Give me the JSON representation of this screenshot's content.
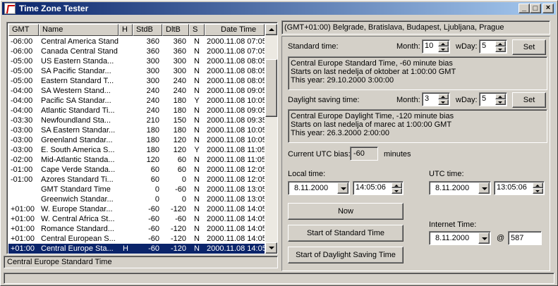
{
  "window": {
    "title": "Time Zone Tester"
  },
  "list": {
    "columns": [
      "GMT",
      "Name",
      "H",
      "StdB",
      "DltB",
      "S",
      "Date Time"
    ],
    "rows": [
      [
        "-06:00",
        "Central America Stand...",
        "",
        "360",
        "360",
        "N",
        "2000.11.08 07:05"
      ],
      [
        "-06:00",
        "Canada Central Stand...",
        "",
        "360",
        "360",
        "N",
        "2000.11.08 07:05"
      ],
      [
        "-05:00",
        "US Eastern Standa...",
        "",
        "300",
        "300",
        "N",
        "2000.11.08 08:05"
      ],
      [
        "-05:00",
        "SA Pacific Standar...",
        "",
        "300",
        "300",
        "N",
        "2000.11.08 08:05"
      ],
      [
        "-05:00",
        "Eastern Standard T...",
        "",
        "300",
        "240",
        "N",
        "2000.11.08 08:05"
      ],
      [
        "-04:00",
        "SA Western Stand...",
        "",
        "240",
        "240",
        "N",
        "2000.11.08 09:05"
      ],
      [
        "-04:00",
        "Pacific SA Standar...",
        "",
        "240",
        "180",
        "Y",
        "2000.11.08 10:05"
      ],
      [
        "-04:00",
        "Atlantic Standard Ti...",
        "",
        "240",
        "180",
        "N",
        "2000.11.08 09:05"
      ],
      [
        "-03:30",
        "Newfoundland Sta...",
        "",
        "210",
        "150",
        "N",
        "2000.11.08 09:35"
      ],
      [
        "-03:00",
        "SA Eastern Standar...",
        "",
        "180",
        "180",
        "N",
        "2000.11.08 10:05"
      ],
      [
        "-03:00",
        "Greenland Standar...",
        "",
        "180",
        "120",
        "N",
        "2000.11.08 10:05"
      ],
      [
        "-03:00",
        "E. South America S...",
        "",
        "180",
        "120",
        "Y",
        "2000.11.08 11:05"
      ],
      [
        "-02:00",
        "Mid-Atlantic Standa...",
        "",
        "120",
        "60",
        "N",
        "2000.11.08 11:05"
      ],
      [
        "-01:00",
        "Cape Verde Standa...",
        "",
        "60",
        "60",
        "N",
        "2000.11.08 12:05"
      ],
      [
        "-01:00",
        "Azores Standard Ti...",
        "",
        "60",
        "0",
        "N",
        "2000.11.08 12:05"
      ],
      [
        "",
        "GMT Standard Time",
        "",
        "0",
        "-60",
        "N",
        "2000.11.08 13:05"
      ],
      [
        "",
        "Greenwich Standar...",
        "",
        "0",
        "0",
        "N",
        "2000.11.08 13:05"
      ],
      [
        "+01:00",
        "W. Europe Standar...",
        "",
        "-60",
        "-120",
        "N",
        "2000.11.08 14:05"
      ],
      [
        "+01:00",
        "W. Central Africa St...",
        "",
        "-60",
        "-60",
        "N",
        "2000.11.08 14:05"
      ],
      [
        "+01:00",
        "Romance Standard...",
        "",
        "-60",
        "-120",
        "N",
        "2000.11.08 14:05"
      ],
      [
        "+01:00",
        "Central European S...",
        "",
        "-60",
        "-120",
        "N",
        "2000.11.08 14:05"
      ],
      [
        "+01:00",
        "Central Europe Sta...",
        "H",
        "-60",
        "-120",
        "N",
        "2000.11.08 14:05"
      ]
    ],
    "selected_index": 21,
    "status": "Central Europe Standard Time"
  },
  "zone_title": "(GMT+01:00) Belgrade, Bratislava, Budapest, Ljubljana, Prague",
  "standard": {
    "label": "Standard time:",
    "month_label": "Month:",
    "month": "10",
    "wday_label": "wDay:",
    "wday": "5",
    "set_label": "Set",
    "info": [
      "Central Europe Standard Time, -60 minute bias",
      "Starts on last nedelja of oktober at 1:00:00 GMT",
      "This year: 29.10.2000 3:00:00"
    ]
  },
  "daylight": {
    "label": "Daylight saving time:",
    "month_label": "Month:",
    "month": "3",
    "wday_label": "wDay:",
    "wday": "5",
    "set_label": "Set",
    "info": [
      "Central Europe Daylight Time, -120 minute bias",
      "Starts on last nedelja of marec at 1:00:00 GMT",
      "This year: 26.3.2000 2:00:00"
    ]
  },
  "utc_bias": {
    "label": "Current UTC bias:",
    "value": "-60",
    "unit": "minutes"
  },
  "local_time": {
    "label": "Local time:",
    "date": "8.11.2000",
    "time": "14:05:06"
  },
  "utc_time": {
    "label": "UTC time:",
    "date": "8.11.2000",
    "time": "13:05:06"
  },
  "buttons": {
    "now": "Now",
    "start_standard": "Start of Standard Time",
    "start_daylight": "Start of Daylight Saving Time"
  },
  "internet_time": {
    "label": "Internet Time:",
    "date": "8.11.2000",
    "at": "@",
    "beats": "587"
  }
}
